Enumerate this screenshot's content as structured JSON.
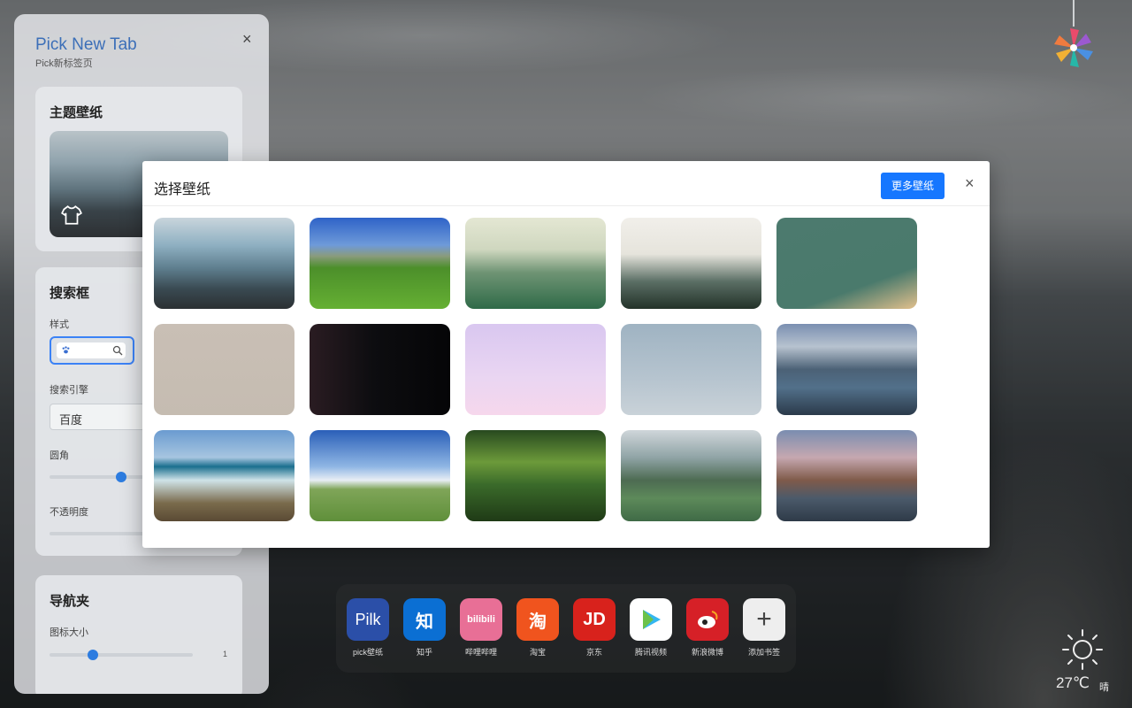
{
  "settings": {
    "title": "Pick New Tab",
    "subtitle": "Pick新标签页",
    "close": "×",
    "theme": {
      "heading": "主题壁纸"
    },
    "search": {
      "heading": "搜索框",
      "style_label": "样式",
      "engine_label": "搜索引擎",
      "engine_value": "百度",
      "radius_label": "圆角",
      "radius_value": 0.58,
      "opacity_label": "不透明度"
    },
    "nav": {
      "heading": "导航夹",
      "icon_size_label": "图标大小",
      "icon_size_value": "1"
    }
  },
  "modal": {
    "title": "选择壁纸",
    "more_button": "更多壁纸",
    "close": "×",
    "wallpapers": [
      {
        "theme": "mountain-mist"
      },
      {
        "theme": "green-meadow"
      },
      {
        "theme": "misty-forest"
      },
      {
        "theme": "white-forest"
      },
      {
        "theme": "anime-teal"
      },
      {
        "theme": "anime-beige"
      },
      {
        "theme": "anime-dark"
      },
      {
        "theme": "anime-pink"
      },
      {
        "theme": "anime-gray"
      },
      {
        "theme": "lake-reeds"
      },
      {
        "theme": "coast-waves"
      },
      {
        "theme": "blue-sky-field"
      },
      {
        "theme": "forest-path"
      },
      {
        "theme": "mountain-lake"
      },
      {
        "theme": "sea-arch"
      }
    ]
  },
  "dock": [
    {
      "label": "pick壁纸",
      "icon": "Pilk",
      "color": "#2b4fa8"
    },
    {
      "label": "知乎",
      "icon": "知",
      "color": "#0b6fd3"
    },
    {
      "label": "哔哩哔哩",
      "icon": "bilibili",
      "color": "#e86f96"
    },
    {
      "label": "淘宝",
      "icon": "淘",
      "color": "#f0541e"
    },
    {
      "label": "京东",
      "icon": "JD",
      "color": "#d8221c"
    },
    {
      "label": "腾讯视频",
      "icon": "play",
      "color": "#ffffff"
    },
    {
      "label": "新浪微博",
      "icon": "weibo",
      "color": "#d62027"
    },
    {
      "label": "添加书签",
      "icon": "+",
      "color": "#eeeeee"
    }
  ],
  "weather": {
    "temperature": "27℃",
    "condition": "晴"
  }
}
